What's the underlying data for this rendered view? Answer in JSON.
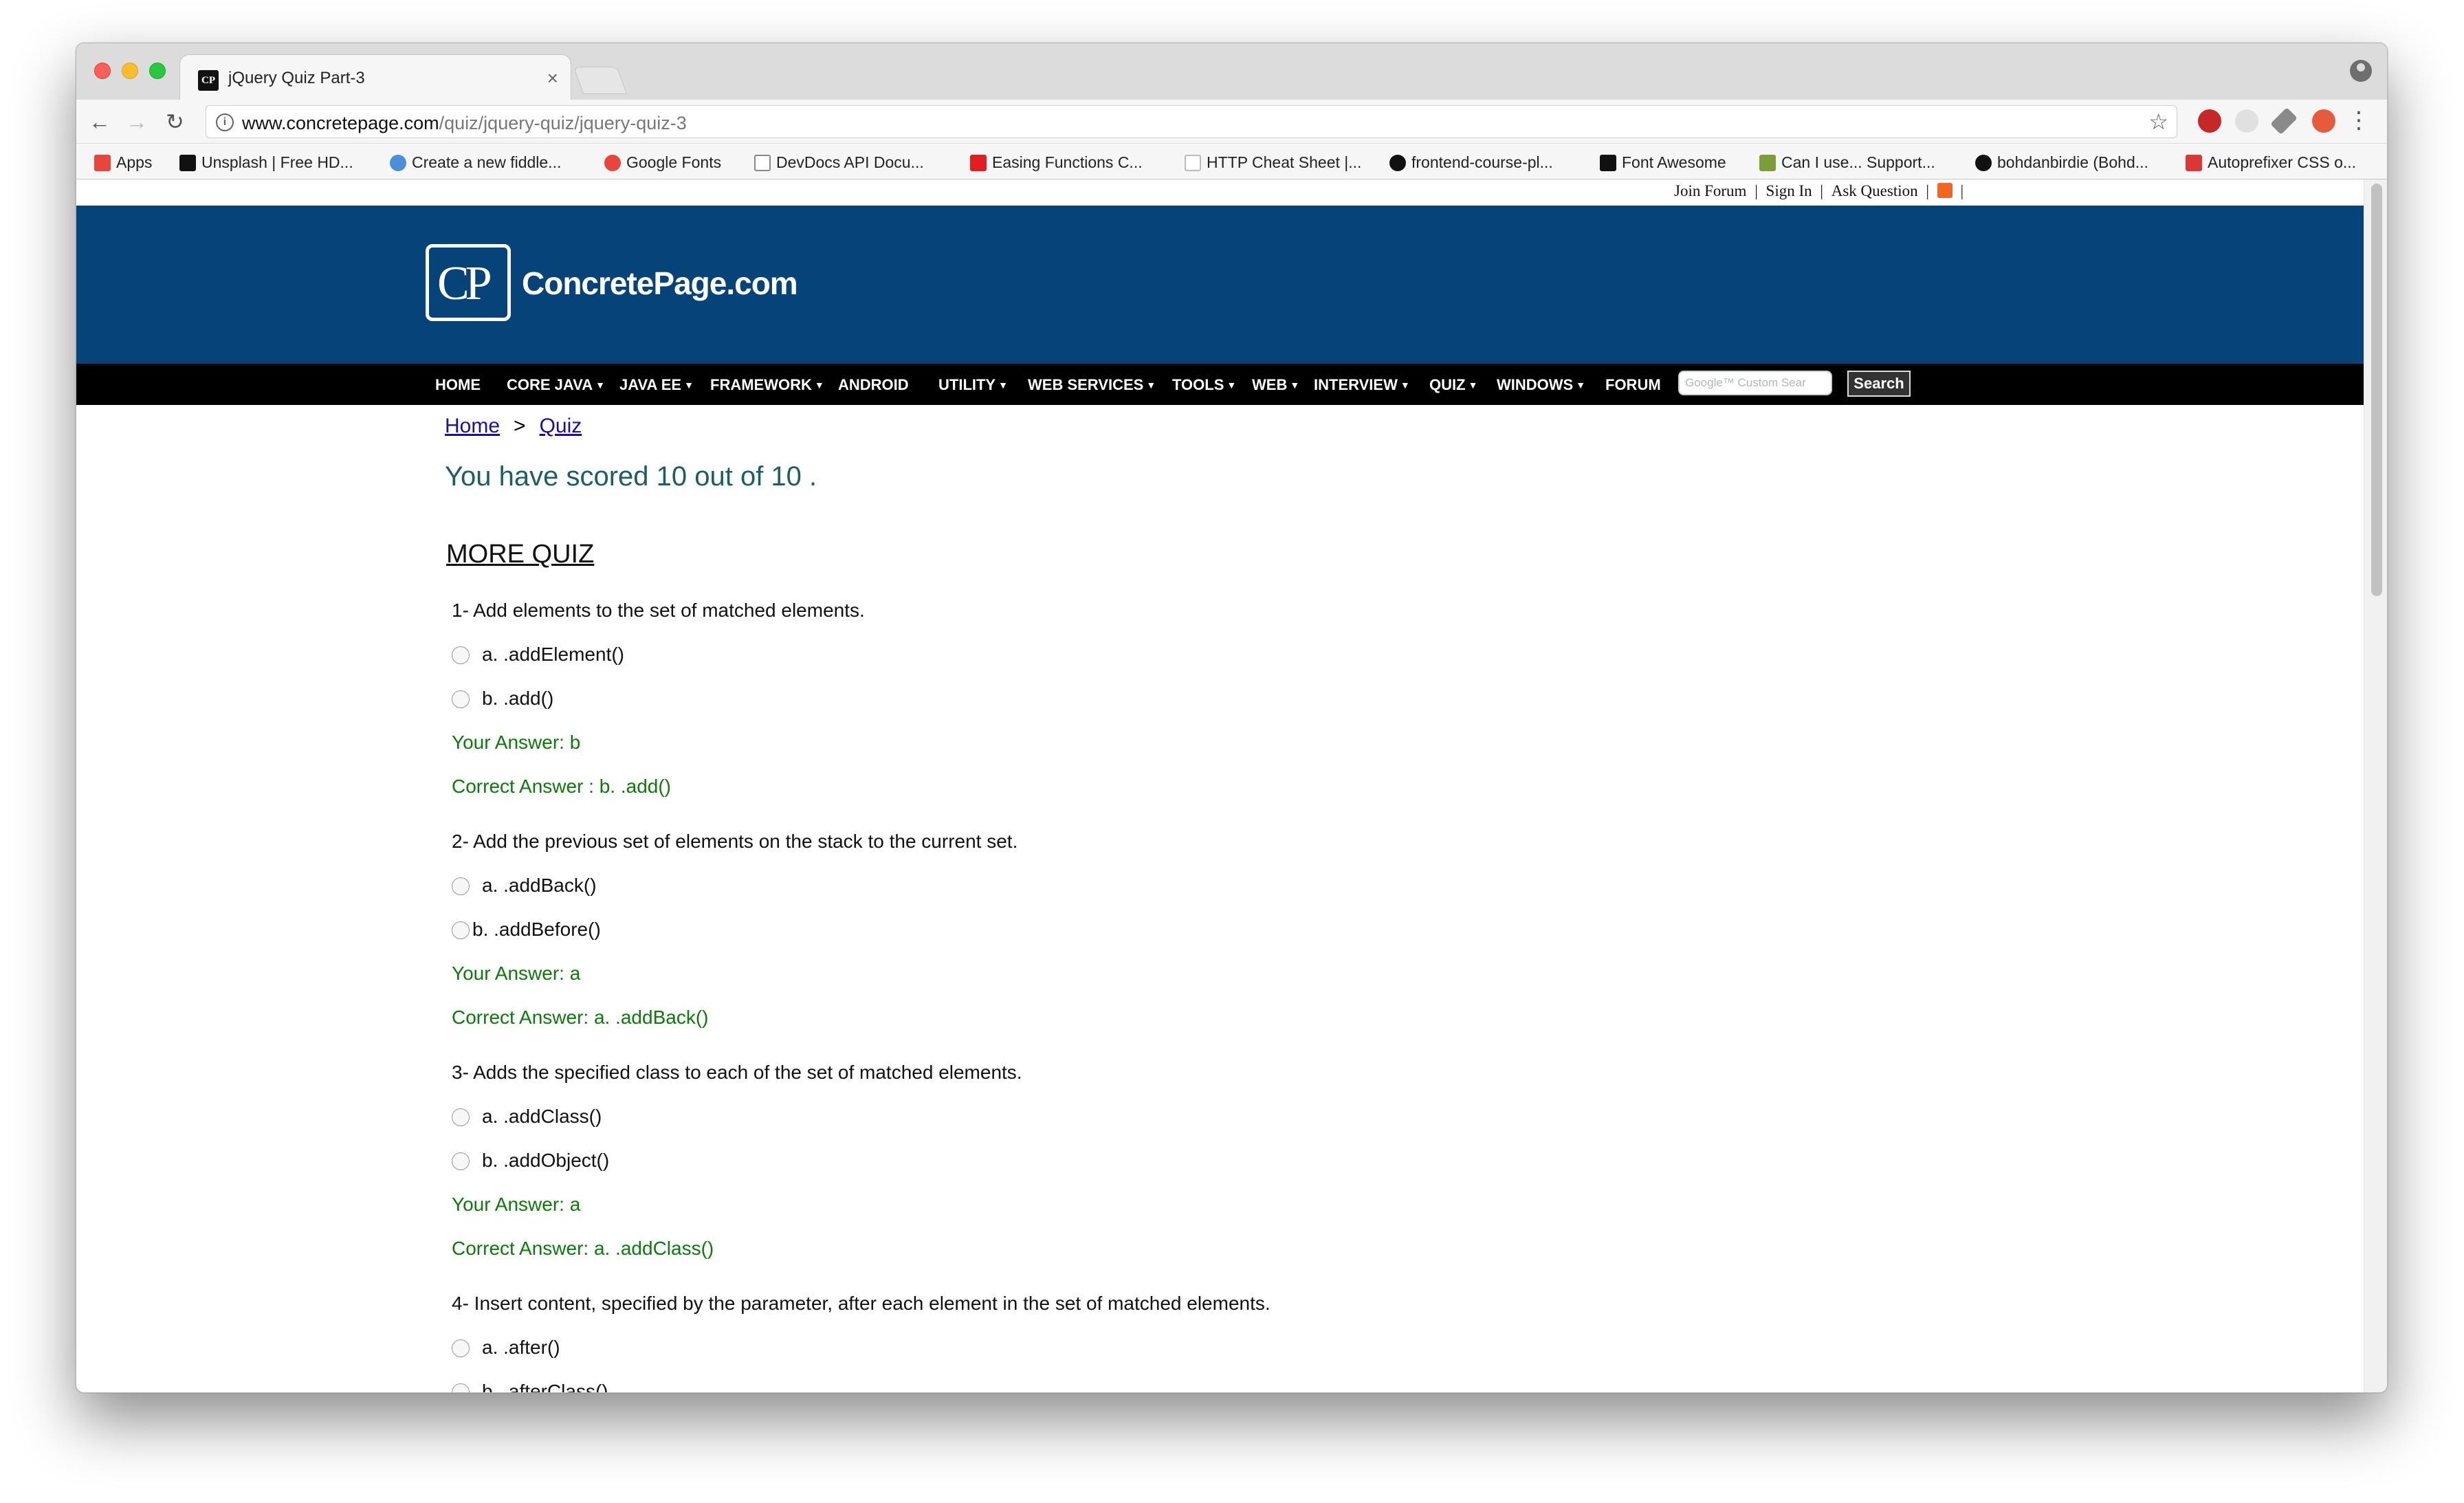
{
  "browser": {
    "tab_title": "jQuery Quiz Part-3",
    "tab_favicon_text": "CP",
    "tab_close": "×",
    "url_host": "www.concretepage.com",
    "url_path": "/quiz/jquery-quiz/jquery-quiz-3",
    "back": "←",
    "forward": "→",
    "reload": "↻",
    "star": "☆",
    "menu": "⋮",
    "bookmarks": [
      {
        "label": "Apps",
        "icon": "apps-grid-icon",
        "color": "#e8453c"
      },
      {
        "label": "Unsplash | Free HD...",
        "icon": "camera-icon",
        "color": "#111111"
      },
      {
        "label": "Create a new fiddle...",
        "icon": "cloud-icon",
        "color": "#4b8fd6"
      },
      {
        "label": "Google Fonts",
        "icon": "google-fonts-icon",
        "color": "#e8453c"
      },
      {
        "label": "DevDocs API Docu...",
        "icon": "devdocs-icon",
        "color": "#888888"
      },
      {
        "label": "Easing Functions C...",
        "icon": "easing-icon",
        "color": "#e01f1f"
      },
      {
        "label": "HTTP Cheat Sheet |...",
        "icon": "page-icon",
        "color": "#bbbbbb"
      },
      {
        "label": "frontend-course-pl...",
        "icon": "github-icon",
        "color": "#111111"
      },
      {
        "label": "Font Awesome",
        "icon": "flag-icon",
        "color": "#111111"
      },
      {
        "label": "Can I use... Support...",
        "icon": "caniuse-icon",
        "color": "#7b9e3a"
      },
      {
        "label": "bohdanbirdie (Bohd...",
        "icon": "github-icon",
        "color": "#111111"
      },
      {
        "label": "Autoprefixer CSS o...",
        "icon": "autoprefixer-icon",
        "color": "#dd3735"
      }
    ]
  },
  "site": {
    "top_links": [
      "Join Forum",
      "Sign In",
      "Ask Question"
    ],
    "logo_mark": "CP",
    "logo_text": "ConcretePage.com",
    "nav": [
      {
        "label": "HOME",
        "caret": false
      },
      {
        "label": "CORE JAVA",
        "caret": true
      },
      {
        "label": "JAVA EE",
        "caret": true
      },
      {
        "label": "FRAMEWORK",
        "caret": true
      },
      {
        "label": "ANDROID",
        "caret": false
      },
      {
        "label": "UTILITY",
        "caret": true
      },
      {
        "label": "WEB SERVICES",
        "caret": true
      },
      {
        "label": "TOOLS",
        "caret": true
      },
      {
        "label": "WEB",
        "caret": true
      },
      {
        "label": "INTERVIEW",
        "caret": true
      },
      {
        "label": "QUIZ",
        "caret": true
      },
      {
        "label": "WINDOWS",
        "caret": true
      },
      {
        "label": "FORUM",
        "caret": false
      }
    ],
    "search_placeholder": "Google™ Custom Sear",
    "search_button": "Search"
  },
  "quiz": {
    "breadcrumb_home": "Home",
    "breadcrumb_sep": ">",
    "breadcrumb_quiz": "Quiz",
    "score_text": "You have scored 10 out of 10 .",
    "more_quiz": "MORE QUIZ",
    "questions": [
      {
        "question": "1- Add elements to the set of matched elements.",
        "options": [
          "a. .addElement()",
          "b. .add()"
        ],
        "your_answer": "Your Answer: b",
        "correct_answer": "Correct Answer : b. .add()"
      },
      {
        "question": "2- Add the previous set of elements on the stack to the current set.",
        "options": [
          "a. .addBack()",
          "b. .addBefore()"
        ],
        "your_answer": "Your Answer: a",
        "correct_answer": "Correct Answer: a. .addBack()"
      },
      {
        "question": "3- Adds the specified class to each of the set of matched elements.",
        "options": [
          "a. .addClass()",
          "b. .addObject()"
        ],
        "your_answer": "Your Answer: a",
        "correct_answer": "Correct Answer: a. .addClass()"
      },
      {
        "question": "4- Insert content, specified by the parameter, after each element in the set of matched elements.",
        "options": [
          "a. .after()",
          "b. .afterClass()"
        ]
      }
    ]
  }
}
